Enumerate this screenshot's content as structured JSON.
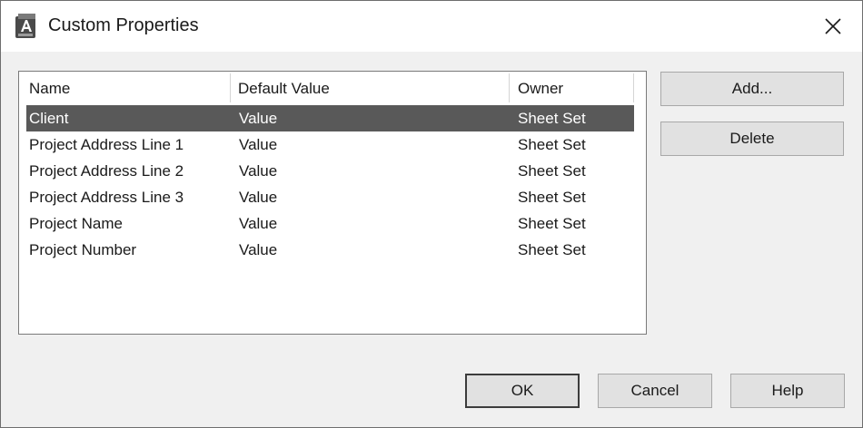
{
  "window": {
    "title": "Custom Properties",
    "app_icon": "autocad-app-icon",
    "close_icon": "close-icon"
  },
  "table": {
    "columns": [
      "Name",
      "Default Value",
      "Owner"
    ],
    "rows": [
      {
        "name": "Client",
        "value": "Value",
        "owner": "Sheet Set",
        "selected": true
      },
      {
        "name": "Project Address Line 1",
        "value": "Value",
        "owner": "Sheet Set",
        "selected": false
      },
      {
        "name": "Project Address Line 2",
        "value": "Value",
        "owner": "Sheet Set",
        "selected": false
      },
      {
        "name": "Project Address Line 3",
        "value": "Value",
        "owner": "Sheet Set",
        "selected": false
      },
      {
        "name": "Project Name",
        "value": "Value",
        "owner": "Sheet Set",
        "selected": false
      },
      {
        "name": "Project Number",
        "value": "Value",
        "owner": "Sheet Set",
        "selected": false
      }
    ]
  },
  "side_buttons": {
    "add": "Add...",
    "delete": "Delete"
  },
  "footer_buttons": {
    "ok": "OK",
    "cancel": "Cancel",
    "help": "Help"
  },
  "colors": {
    "selection": "#595959",
    "dialog_bg": "#f0f0f0",
    "button_bg": "#e1e1e1"
  }
}
